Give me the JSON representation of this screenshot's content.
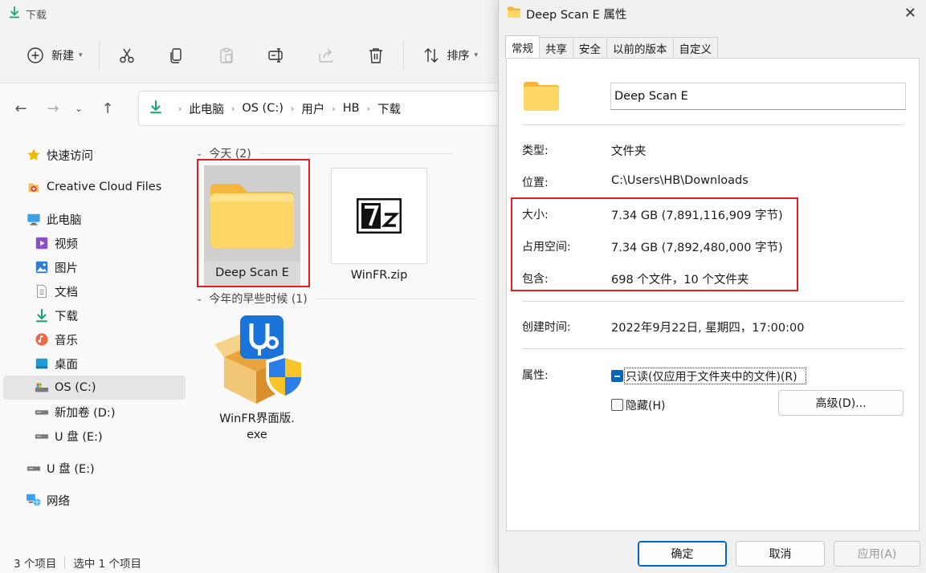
{
  "explorer": {
    "window_title": "下载",
    "toolbar": {
      "new_label": "新建",
      "sort_label": "排序"
    },
    "breadcrumbs": [
      "此电脑",
      "OS (C:)",
      "用户",
      "HB",
      "下载"
    ],
    "sidebar": {
      "items": [
        {
          "label": "快速访问",
          "icon": "star-icon"
        },
        {
          "label": "Creative Cloud Files",
          "icon": "creative-cloud-icon"
        },
        {
          "label": "此电脑",
          "icon": "computer-icon"
        },
        {
          "label": "视频",
          "icon": "video-icon"
        },
        {
          "label": "图片",
          "icon": "pictures-icon"
        },
        {
          "label": "文档",
          "icon": "documents-icon"
        },
        {
          "label": "下载",
          "icon": "download-icon"
        },
        {
          "label": "音乐",
          "icon": "music-icon"
        },
        {
          "label": "桌面",
          "icon": "desktop-icon"
        },
        {
          "label": "OS (C:)",
          "icon": "drive-icon",
          "selected": true
        },
        {
          "label": "新加卷 (D:)",
          "icon": "drive-icon"
        },
        {
          "label": "U 盘 (E:)",
          "icon": "drive-icon"
        },
        {
          "label": "U 盘 (E:)",
          "icon": "drive-icon"
        },
        {
          "label": "网络",
          "icon": "network-icon"
        }
      ]
    },
    "groups": [
      {
        "header": "今天 (2)",
        "files": [
          {
            "name": "Deep Scan E",
            "type": "folder",
            "selected": true
          },
          {
            "name": "WinFR.zip",
            "type": "7z"
          }
        ]
      },
      {
        "header": "今年的早些时候 (1)",
        "files": [
          {
            "name": "WinFR界面版.",
            "name2": "exe",
            "type": "exe"
          }
        ]
      }
    ],
    "status": {
      "count": "3 个项目",
      "selected": "选中 1 个项目"
    }
  },
  "dialog": {
    "title": "Deep Scan E 属性",
    "tabs": [
      "常规",
      "共享",
      "安全",
      "以前的版本",
      "自定义"
    ],
    "active_tab": "常规",
    "folder_name": "Deep Scan E",
    "rows": {
      "type": {
        "label": "类型:",
        "value": "文件夹"
      },
      "location": {
        "label": "位置:",
        "value": "C:\\Users\\HB\\Downloads"
      },
      "size": {
        "label": "大小:",
        "value": "7.34 GB (7,891,116,909 字节)"
      },
      "size_on_disk": {
        "label": "占用空间:",
        "value": "7.34 GB (7,892,480,000 字节)"
      },
      "contains": {
        "label": "包含:",
        "value": "698 个文件，10 个文件夹"
      },
      "created": {
        "label": "创建时间:",
        "value": "2022年9月22日, 星期四，17:00:00"
      },
      "attributes": {
        "label": "属性:"
      }
    },
    "readonly_label": "只读(仅应用于文件夹中的文件)(R)",
    "hidden_label": "隐藏(H)",
    "advanced_label": "高级(D)...",
    "buttons": {
      "ok": "确定",
      "cancel": "取消",
      "apply": "应用(A)"
    },
    "colors": {
      "accent": "#0067c0",
      "highlight_box": "#e02020",
      "folder_yellow": "#ffd766"
    }
  }
}
